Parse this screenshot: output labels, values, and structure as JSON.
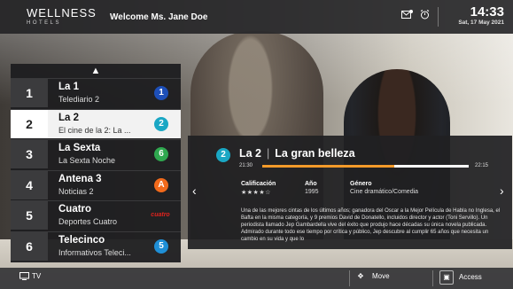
{
  "header": {
    "brand_line1": "WELLNESS",
    "brand_line2": "HOTELS",
    "welcome": "Welcome Ms. Jane Doe",
    "time": "14:33",
    "date": "Sat, 17 May 2021"
  },
  "channels": [
    {
      "number": "1",
      "name": "La 1",
      "program": "Telediario 2",
      "logo": "1",
      "logo_color": "#1d4fb8",
      "active": false
    },
    {
      "number": "2",
      "name": "La 2",
      "program": "El cine de la 2: La ...",
      "logo": "2",
      "logo_color": "#1aa7c4",
      "active": true
    },
    {
      "number": "3",
      "name": "La Sexta",
      "program": "La Sexta Noche",
      "logo": "6",
      "logo_color": "#2fa84f",
      "active": false
    },
    {
      "number": "4",
      "name": "Antena 3",
      "program": "Noticias 2",
      "logo": "A",
      "logo_color": "#f26a1b",
      "active": false
    },
    {
      "number": "5",
      "name": "Cuatro",
      "program": "Deportes Cuatro",
      "logo": "cuatro",
      "logo_color": "#e0231e",
      "active": false
    },
    {
      "number": "6",
      "name": "Telecinco",
      "program": "Informativos Teleci...",
      "logo": "5",
      "logo_color": "#1f8fd6",
      "active": false
    }
  ],
  "detail": {
    "channel_logo": "2",
    "channel_name": "La 2",
    "title": "La gran belleza",
    "start": "21:30",
    "end": "22:15",
    "progress": 0.64,
    "rating_label": "Calificación",
    "rating_stars": "★★★★☆",
    "year_label": "Año",
    "year": "1995",
    "genre_label": "Género",
    "genre": "Cine dramático/Comedia",
    "description": "Una de las mejores cintas de los últimos años; ganadora del Oscar a la Mejor Película de Habla no Inglesa, el Bafta en la misma categoría, y 9 premios David de Donatello, incluidos director y actor (Toni Servillo). Un periodista llamado Jep Gambardella vive del éxito que produjo hace décadas su única novela publicada. Admirado durante todo ese tiempo por crítica y público, Jep descubre al cumplir 65 años que necesita un cambio en su vida y que lo"
  },
  "footer": {
    "tv_label": "TV",
    "move_label": "Move",
    "access_label": "Access"
  }
}
